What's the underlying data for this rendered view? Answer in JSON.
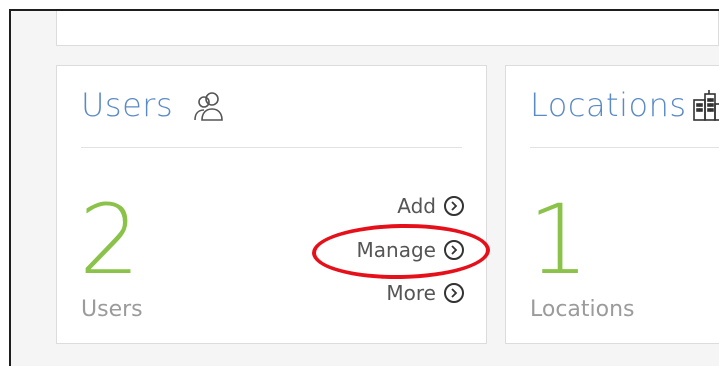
{
  "cards": {
    "users": {
      "title": "Users",
      "icon": "users-icon",
      "count": "2",
      "count_label": "Users",
      "actions": {
        "add": "Add",
        "manage": "Manage",
        "more": "More"
      }
    },
    "locations": {
      "title": "Locations",
      "icon": "building-icon",
      "count": "1",
      "count_label": "Locations"
    }
  },
  "colors": {
    "title": "#5a8ac6",
    "count": "#8bc34a",
    "label": "#9b9b9b",
    "highlight": "#e6101a"
  }
}
